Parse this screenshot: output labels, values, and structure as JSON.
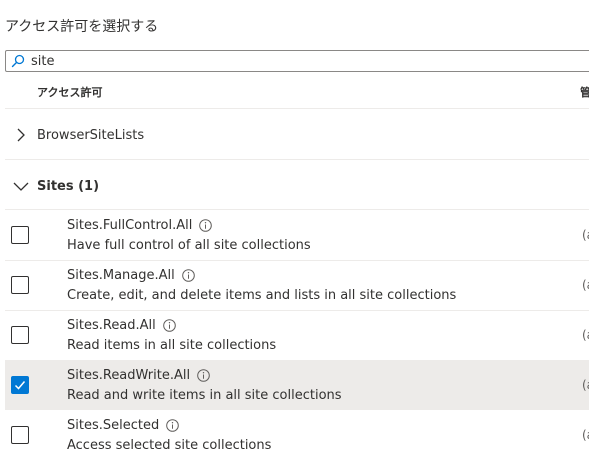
{
  "panel": {
    "title": "アクセス許可を選択する"
  },
  "search": {
    "value": "site",
    "placeholder": ""
  },
  "table": {
    "columns": [
      "アクセス許可",
      "管"
    ]
  },
  "groups": [
    {
      "label": "BrowserSiteLists",
      "expanded": false
    },
    {
      "label": "Sites (1)",
      "expanded": true
    }
  ],
  "permissions": [
    {
      "name": "Sites.FullControl.All",
      "description": "Have full control of all site collections",
      "admin": "(a",
      "checked": false
    },
    {
      "name": "Sites.Manage.All",
      "description": "Create, edit, and delete items and lists in all site collections",
      "admin": "(a",
      "checked": false
    },
    {
      "name": "Sites.Read.All",
      "description": "Read items in all site collections",
      "admin": "(a",
      "checked": false
    },
    {
      "name": "Sites.ReadWrite.All",
      "description": "Read and write items in all site collections",
      "admin": "(a",
      "checked": true
    },
    {
      "name": "Sites.Selected",
      "description": "Access selected site collections",
      "admin": "(a",
      "checked": false
    }
  ],
  "icons": {
    "search": "search-icon",
    "collapsed": "chevron-right-icon",
    "expanded": "chevron-down-icon",
    "info": "info-icon",
    "check": "checkmark-icon"
  },
  "colors": {
    "accent": "#0078d4",
    "selected_row": "#edebe9",
    "text": "#323130",
    "divider": "#edebe9"
  }
}
